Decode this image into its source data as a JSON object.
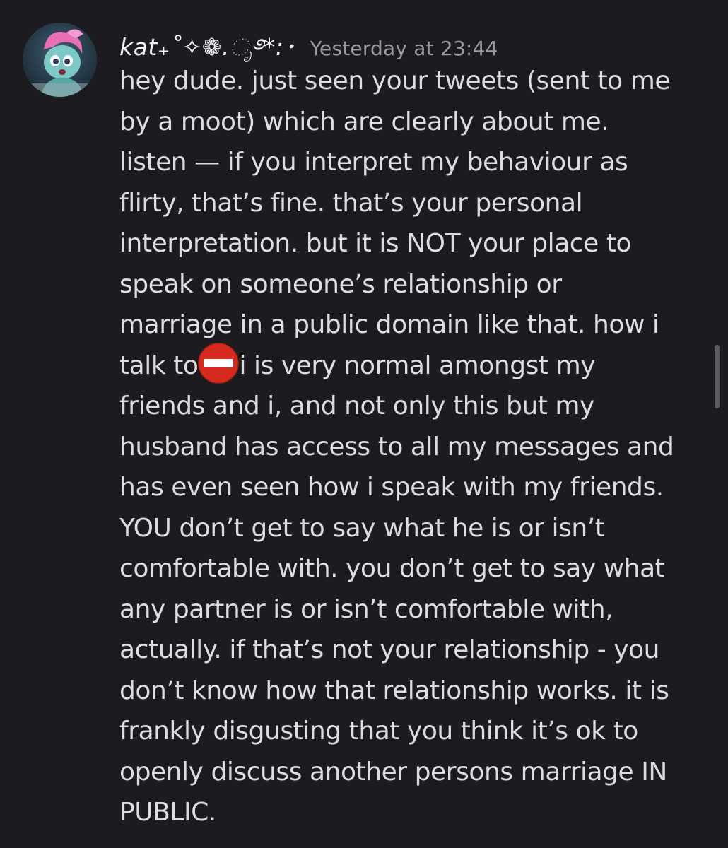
{
  "message": {
    "username": "kat₊˚✧❁.ೃ࿔*:･",
    "timestamp": "Yesterday at 23:44",
    "lines": [
      "hey dude. just seen your tweets (sent to me",
      "by a moot) which are clearly about me.",
      "listen — if you interpret my behaviour as",
      "flirty, that’s fine. that’s your personal",
      "interpretation. but it is NOT your place to",
      "speak on someone’s relationship or",
      "marriage in a public domain like that. how i",
      "talk to",
      "friends and i, and not only this but my",
      "husband has access to all my messages and",
      "has even seen how i speak with my friends.",
      "YOU don’t get to say what he is or isn’t",
      "comfortable with. you don’t get to say what",
      "any partner is or isn’t comfortable with,",
      "actually. if that’s not your relationship - you",
      "don’t know how that relationship works. it is",
      "frankly disgusting that you think it’s ok to",
      "openly discuss another persons marriage IN",
      "PUBLIC."
    ],
    "line8_tail": "i is very normal amongst my",
    "redaction_icon": "no-entry-emoji"
  },
  "colors": {
    "background": "#1c1c20",
    "text": "#dcdde0",
    "username": "#f2f3f5",
    "timestamp": "#9a9ca3",
    "redaction": "#d42b1e"
  }
}
